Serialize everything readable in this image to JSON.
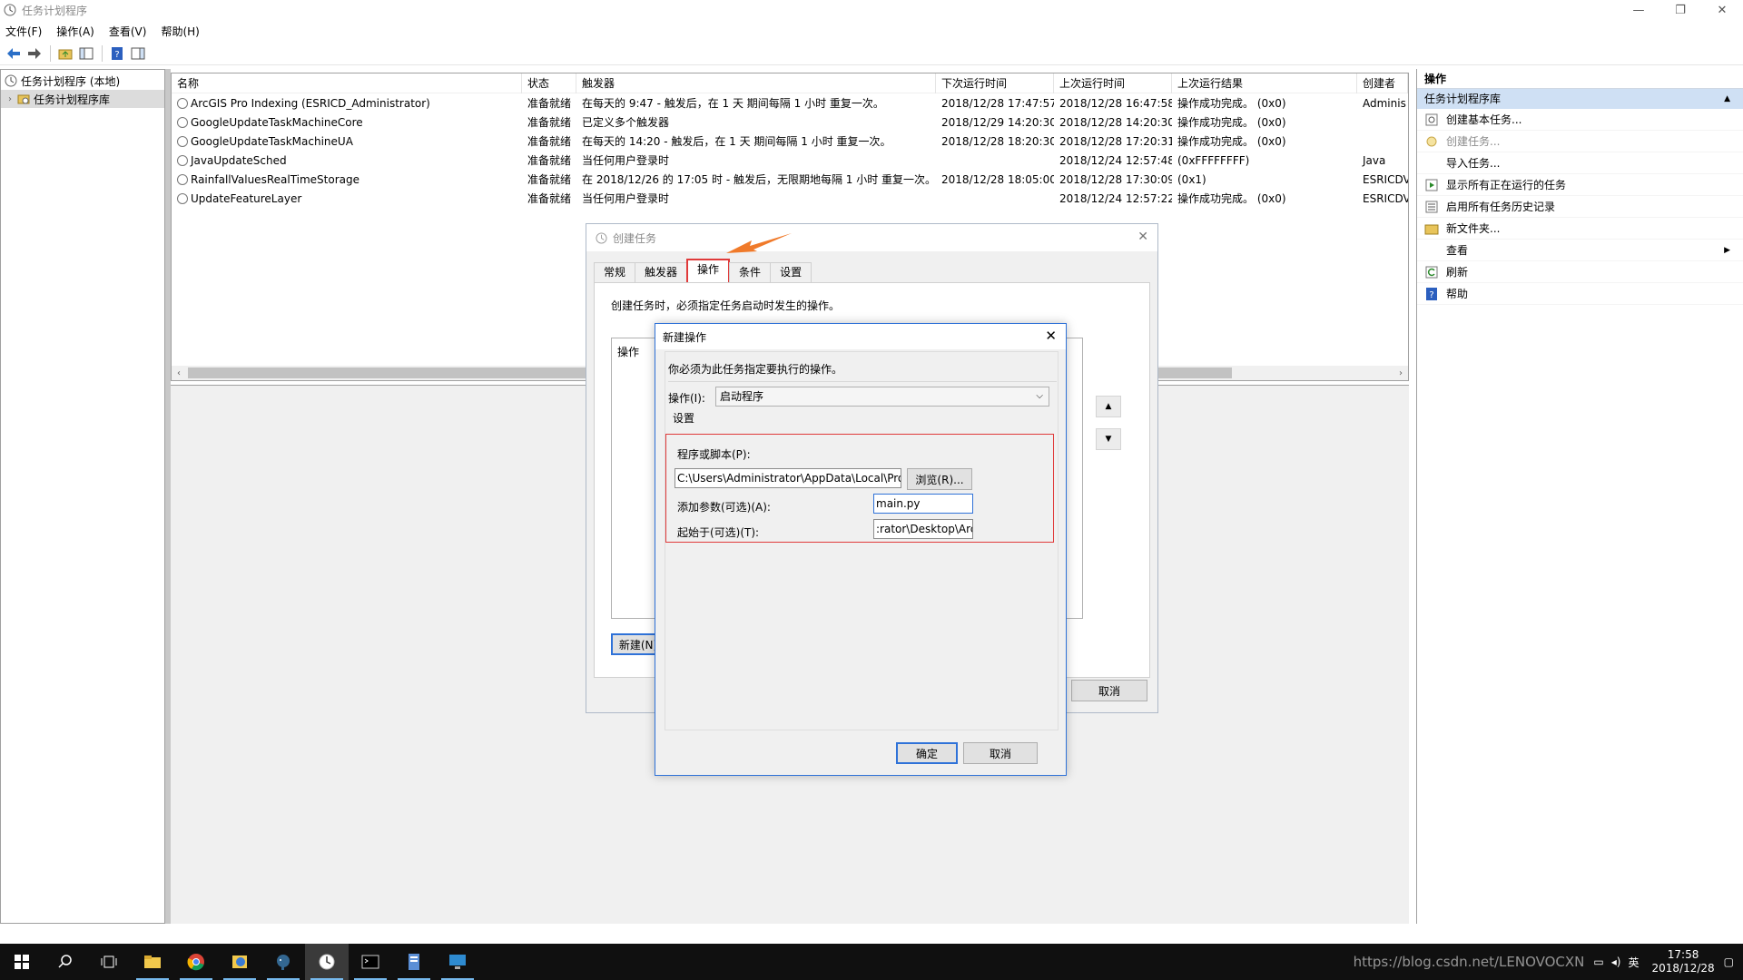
{
  "window": {
    "title": "任务计划程序",
    "controls": [
      "—",
      "❐",
      "✕"
    ]
  },
  "menu": [
    "文件(F)",
    "操作(A)",
    "查看(V)",
    "帮助(H)"
  ],
  "tree": {
    "root": "任务计划程序 (本地)",
    "child": "任务计划程序库"
  },
  "task_table": {
    "headers": [
      "名称",
      "状态",
      "触发器",
      "下次运行时间",
      "上次运行时间",
      "上次运行结果",
      "创建者"
    ],
    "rows": [
      [
        "ArcGIS Pro Indexing (ESRICD_Administrator)",
        "准备就绪",
        "在每天的 9:47 - 触发后，在 1 天 期间每隔 1 小时 重复一次。",
        "2018/12/28 17:47:57",
        "2018/12/28 16:47:58",
        "操作成功完成。 (0x0)",
        "Adminis"
      ],
      [
        "GoogleUpdateTaskMachineCore",
        "准备就绪",
        "已定义多个触发器",
        "2018/12/29 14:20:30",
        "2018/12/28 14:20:30",
        "操作成功完成。 (0x0)",
        ""
      ],
      [
        "GoogleUpdateTaskMachineUA",
        "准备就绪",
        "在每天的 14:20 - 触发后，在 1 天 期间每隔 1 小时 重复一次。",
        "2018/12/28 18:20:30",
        "2018/12/28 17:20:31",
        "操作成功完成。 (0x0)",
        ""
      ],
      [
        "JavaUpdateSched",
        "准备就绪",
        "当任何用户登录时",
        "",
        "2018/12/24 12:57:48",
        "(0xFFFFFFFF)",
        "Java"
      ],
      [
        "RainfallValuesRealTimeStorage",
        "准备就绪",
        "在 2018/12/26 的 17:05 时 - 触发后，无限期地每隔 1 小时 重复一次。",
        "2018/12/28 18:05:00",
        "2018/12/28 17:30:09",
        "(0x1)",
        "ESRICDV"
      ],
      [
        "UpdateFeatureLayer",
        "准备就绪",
        "当任何用户登录时",
        "",
        "2018/12/24 12:57:22",
        "操作成功完成。 (0x0)",
        "ESRICDV"
      ]
    ]
  },
  "actions_pane": {
    "header": "操作",
    "group": "任务计划程序库",
    "items": [
      {
        "label": "创建基本任务...",
        "icon": "basic-task-icon",
        "disabled": false
      },
      {
        "label": "创建任务...",
        "icon": "create-task-icon",
        "disabled": true
      },
      {
        "label": "导入任务...",
        "icon": "",
        "disabled": false
      },
      {
        "label": "显示所有正在运行的任务",
        "icon": "running-tasks-icon",
        "disabled": false
      },
      {
        "label": "启用所有任务历史记录",
        "icon": "history-icon",
        "disabled": false
      },
      {
        "label": "新文件夹...",
        "icon": "folder-icon",
        "disabled": false
      },
      {
        "label": "查看",
        "icon": "",
        "disabled": false,
        "submenu": true
      },
      {
        "label": "刷新",
        "icon": "refresh-icon",
        "disabled": false
      },
      {
        "label": "帮助",
        "icon": "help-icon",
        "disabled": false
      }
    ]
  },
  "create_task": {
    "title": "创建任务",
    "tabs": [
      "常规",
      "触发器",
      "操作",
      "条件",
      "设置"
    ],
    "active_tab": "操作",
    "description": "创建任务时，必须指定任务启动时发生的操作。",
    "list_header": "操作",
    "new_button": "新建(N)",
    "cancel_button": "取消"
  },
  "new_action": {
    "title": "新建操作",
    "description": "你必须为此任务指定要执行的操作。",
    "action_label": "操作(I):",
    "action_value": "启动程序",
    "settings_label": "设置",
    "program_label": "程序或脚本(P):",
    "program_value": "C:\\Users\\Administrator\\AppData\\Local\\Programs\\Py",
    "browse_button": "浏览(R)...",
    "args_label": "添加参数(可选)(A):",
    "args_value": "main.py",
    "start_label": "起始于(可选)(T):",
    "start_value": ":rator\\Desktop\\ArcGIS",
    "ok_button": "确定",
    "cancel_button": "取消"
  },
  "taskbar": {
    "watermark": "https://blog.csdn.net/LENOVOCXN",
    "ime": "英",
    "time": "17:58",
    "date": "2018/12/28"
  },
  "colors": {
    "accent": "#2f72d8",
    "highlight_red": "#e03a3a",
    "annotation_arrow": "#f07a2a",
    "actions_group_bg": "#cfe0f4"
  }
}
